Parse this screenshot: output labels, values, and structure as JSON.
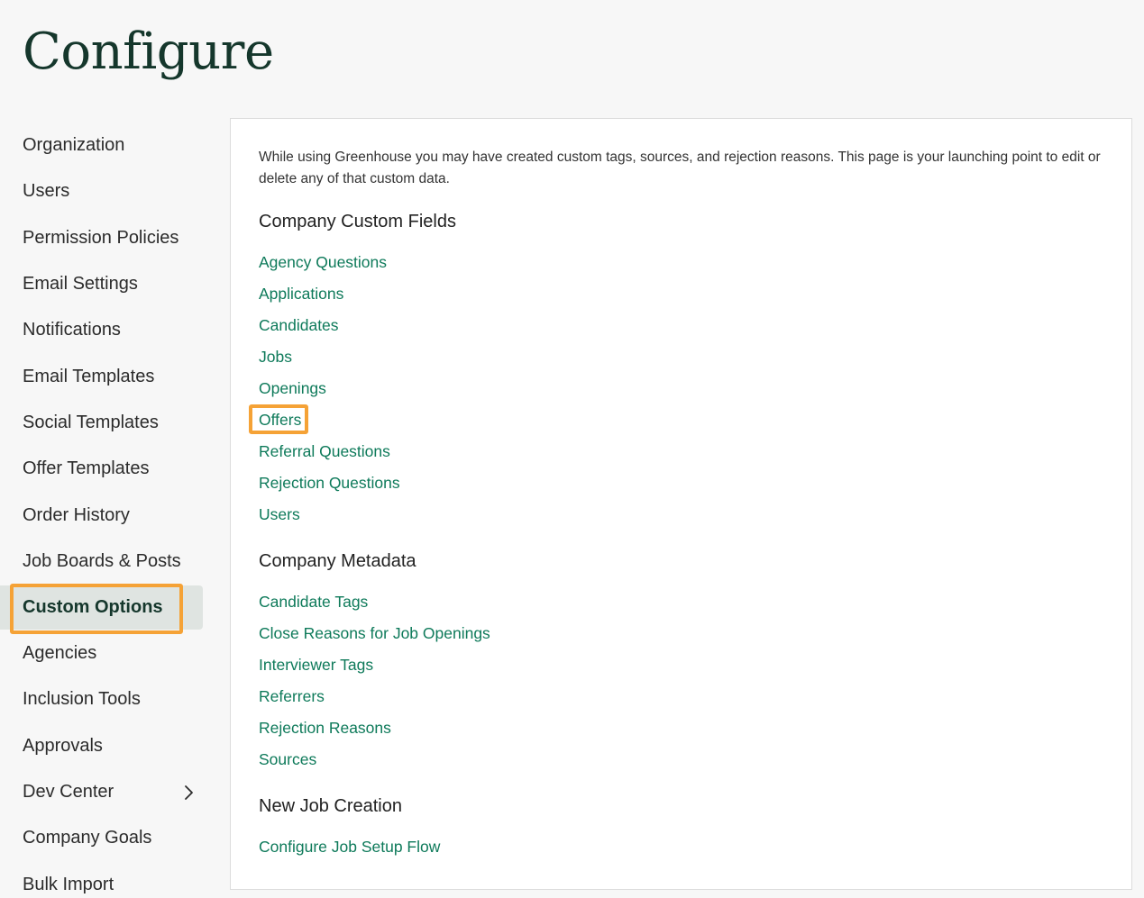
{
  "page": {
    "title": "Configure"
  },
  "sidebar": {
    "items": [
      {
        "label": "Organization"
      },
      {
        "label": "Users"
      },
      {
        "label": "Permission Policies"
      },
      {
        "label": "Email Settings"
      },
      {
        "label": "Notifications"
      },
      {
        "label": "Email Templates"
      },
      {
        "label": "Social Templates"
      },
      {
        "label": "Offer Templates"
      },
      {
        "label": "Order History"
      },
      {
        "label": "Job Boards & Posts"
      },
      {
        "label": "Custom Options",
        "active": true
      },
      {
        "label": "Agencies"
      },
      {
        "label": "Inclusion Tools"
      },
      {
        "label": "Approvals"
      },
      {
        "label": "Dev Center",
        "icon": "chevron-right-icon"
      },
      {
        "label": "Company Goals"
      },
      {
        "label": "Bulk Import"
      }
    ]
  },
  "content": {
    "intro": "While using Greenhouse you may have created custom tags, sources, and rejection reasons. This page is your launching point to edit or delete any of that custom data.",
    "sections": [
      {
        "heading": "Company Custom Fields",
        "links": [
          "Agency Questions",
          "Applications",
          "Candidates",
          "Jobs",
          "Openings",
          "Offers",
          "Referral Questions",
          "Rejection Questions",
          "Users"
        ]
      },
      {
        "heading": "Company Metadata",
        "links": [
          "Candidate Tags",
          "Close Reasons for Job Openings",
          "Interviewer Tags",
          "Referrers",
          "Rejection Reasons",
          "Sources"
        ]
      },
      {
        "heading": "New Job Creation",
        "links": [
          "Configure Job Setup Flow"
        ]
      }
    ]
  },
  "colors": {
    "title": "#15372c",
    "link": "#0e7a5a",
    "highlight": "#f5a236",
    "active_bg": "#dfe4e1"
  }
}
